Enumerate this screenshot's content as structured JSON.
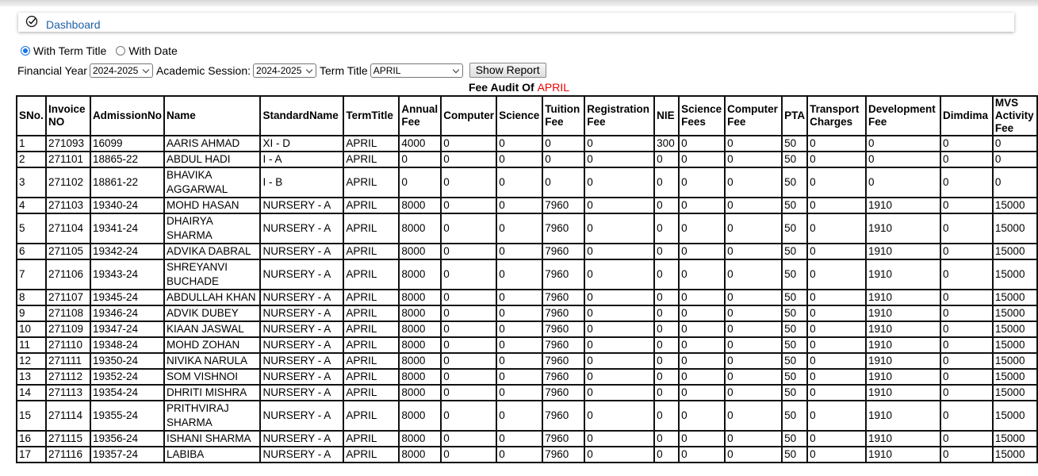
{
  "dashboard": {
    "link_label": "Dashboard",
    "icon": "check-circle-icon"
  },
  "mode": {
    "options": [
      {
        "label": "With Term Title",
        "checked": true
      },
      {
        "label": "With Date",
        "checked": false
      }
    ]
  },
  "filters": {
    "financial_year_label": "Financial Year",
    "financial_year_value": "2024-2025",
    "academic_session_label": "Academic Session:",
    "academic_session_value": "2024-2025",
    "term_title_label": "Term Title",
    "term_title_value": "APRIL",
    "show_report_label": "Show Report"
  },
  "report": {
    "title_prefix": "Fee Audit Of",
    "term": "APRIL"
  },
  "table": {
    "columns": [
      "SNo.",
      "Invoice NO",
      "AdmissionNo",
      "Name",
      "StandardName",
      "TermTitle",
      "Annual Fee",
      "Computer",
      "Science",
      "Tuition Fee",
      "Registration Fee",
      "NIE",
      "Science Fees",
      "Computer Fee",
      "PTA",
      "Transport Charges",
      "Development Fee",
      "Dimdima",
      "MVS Activity Fee"
    ],
    "rows": [
      [
        "1",
        "271093",
        "16099",
        "AARIS AHMAD",
        "XI - D",
        "APRIL",
        "4000",
        "0",
        "0",
        "0",
        "0",
        "300",
        "0",
        "0",
        "50",
        "0",
        "0",
        "0",
        "0"
      ],
      [
        "2",
        "271101",
        "18865-22",
        "ABDUL HADI",
        "I - A",
        "APRIL",
        "0",
        "0",
        "0",
        "0",
        "0",
        "0",
        "0",
        "0",
        "50",
        "0",
        "0",
        "0",
        "0"
      ],
      [
        "3",
        "271102",
        "18861-22",
        "BHAVIKA AGGARWAL",
        "I - B",
        "APRIL",
        "0",
        "0",
        "0",
        "0",
        "0",
        "0",
        "0",
        "0",
        "50",
        "0",
        "0",
        "0",
        "0"
      ],
      [
        "4",
        "271103",
        "19340-24",
        "MOHD HASAN",
        "NURSERY - A",
        "APRIL",
        "8000",
        "0",
        "0",
        "7960",
        "0",
        "0",
        "0",
        "0",
        "50",
        "0",
        "1910",
        "0",
        "15000"
      ],
      [
        "5",
        "271104",
        "19341-24",
        "DHAIRYA SHARMA",
        "NURSERY - A",
        "APRIL",
        "8000",
        "0",
        "0",
        "7960",
        "0",
        "0",
        "0",
        "0",
        "50",
        "0",
        "1910",
        "0",
        "15000"
      ],
      [
        "6",
        "271105",
        "19342-24",
        "ADVIKA DABRAL",
        "NURSERY - A",
        "APRIL",
        "8000",
        "0",
        "0",
        "7960",
        "0",
        "0",
        "0",
        "0",
        "50",
        "0",
        "1910",
        "0",
        "15000"
      ],
      [
        "7",
        "271106",
        "19343-24",
        "SHREYANVI BUCHADE",
        "NURSERY - A",
        "APRIL",
        "8000",
        "0",
        "0",
        "7960",
        "0",
        "0",
        "0",
        "0",
        "50",
        "0",
        "1910",
        "0",
        "15000"
      ],
      [
        "8",
        "271107",
        "19345-24",
        "ABDULLAH KHAN",
        "NURSERY - A",
        "APRIL",
        "8000",
        "0",
        "0",
        "7960",
        "0",
        "0",
        "0",
        "0",
        "50",
        "0",
        "1910",
        "0",
        "15000"
      ],
      [
        "9",
        "271108",
        "19346-24",
        "ADVIK DUBEY",
        "NURSERY - A",
        "APRIL",
        "8000",
        "0",
        "0",
        "7960",
        "0",
        "0",
        "0",
        "0",
        "50",
        "0",
        "1910",
        "0",
        "15000"
      ],
      [
        "10",
        "271109",
        "19347-24",
        "KIAAN JASWAL",
        "NURSERY - A",
        "APRIL",
        "8000",
        "0",
        "0",
        "7960",
        "0",
        "0",
        "0",
        "0",
        "50",
        "0",
        "1910",
        "0",
        "15000"
      ],
      [
        "11",
        "271110",
        "19348-24",
        "MOHD ZOHAN",
        "NURSERY - A",
        "APRIL",
        "8000",
        "0",
        "0",
        "7960",
        "0",
        "0",
        "0",
        "0",
        "50",
        "0",
        "1910",
        "0",
        "15000"
      ],
      [
        "12",
        "271111",
        "19350-24",
        "NIVIKA NARULA",
        "NURSERY - A",
        "APRIL",
        "8000",
        "0",
        "0",
        "7960",
        "0",
        "0",
        "0",
        "0",
        "50",
        "0",
        "1910",
        "0",
        "15000"
      ],
      [
        "13",
        "271112",
        "19352-24",
        "SOM VISHNOI",
        "NURSERY - A",
        "APRIL",
        "8000",
        "0",
        "0",
        "7960",
        "0",
        "0",
        "0",
        "0",
        "50",
        "0",
        "1910",
        "0",
        "15000"
      ],
      [
        "14",
        "271113",
        "19354-24",
        "DHRITI MISHRA",
        "NURSERY - A",
        "APRIL",
        "8000",
        "0",
        "0",
        "7960",
        "0",
        "0",
        "0",
        "0",
        "50",
        "0",
        "1910",
        "0",
        "15000"
      ],
      [
        "15",
        "271114",
        "19355-24",
        "PRITHVIRAJ SHARMA",
        "NURSERY - A",
        "APRIL",
        "8000",
        "0",
        "0",
        "7960",
        "0",
        "0",
        "0",
        "0",
        "50",
        "0",
        "1910",
        "0",
        "15000"
      ],
      [
        "16",
        "271115",
        "19356-24",
        "ISHANI SHARMA",
        "NURSERY - A",
        "APRIL",
        "8000",
        "0",
        "0",
        "7960",
        "0",
        "0",
        "0",
        "0",
        "50",
        "0",
        "1910",
        "0",
        "15000"
      ],
      [
        "17",
        "271116",
        "19357-24",
        "LABIBA",
        "NURSERY - A",
        "APRIL",
        "8000",
        "0",
        "0",
        "7960",
        "0",
        "0",
        "0",
        "0",
        "50",
        "0",
        "1910",
        "0",
        "15000"
      ]
    ]
  }
}
